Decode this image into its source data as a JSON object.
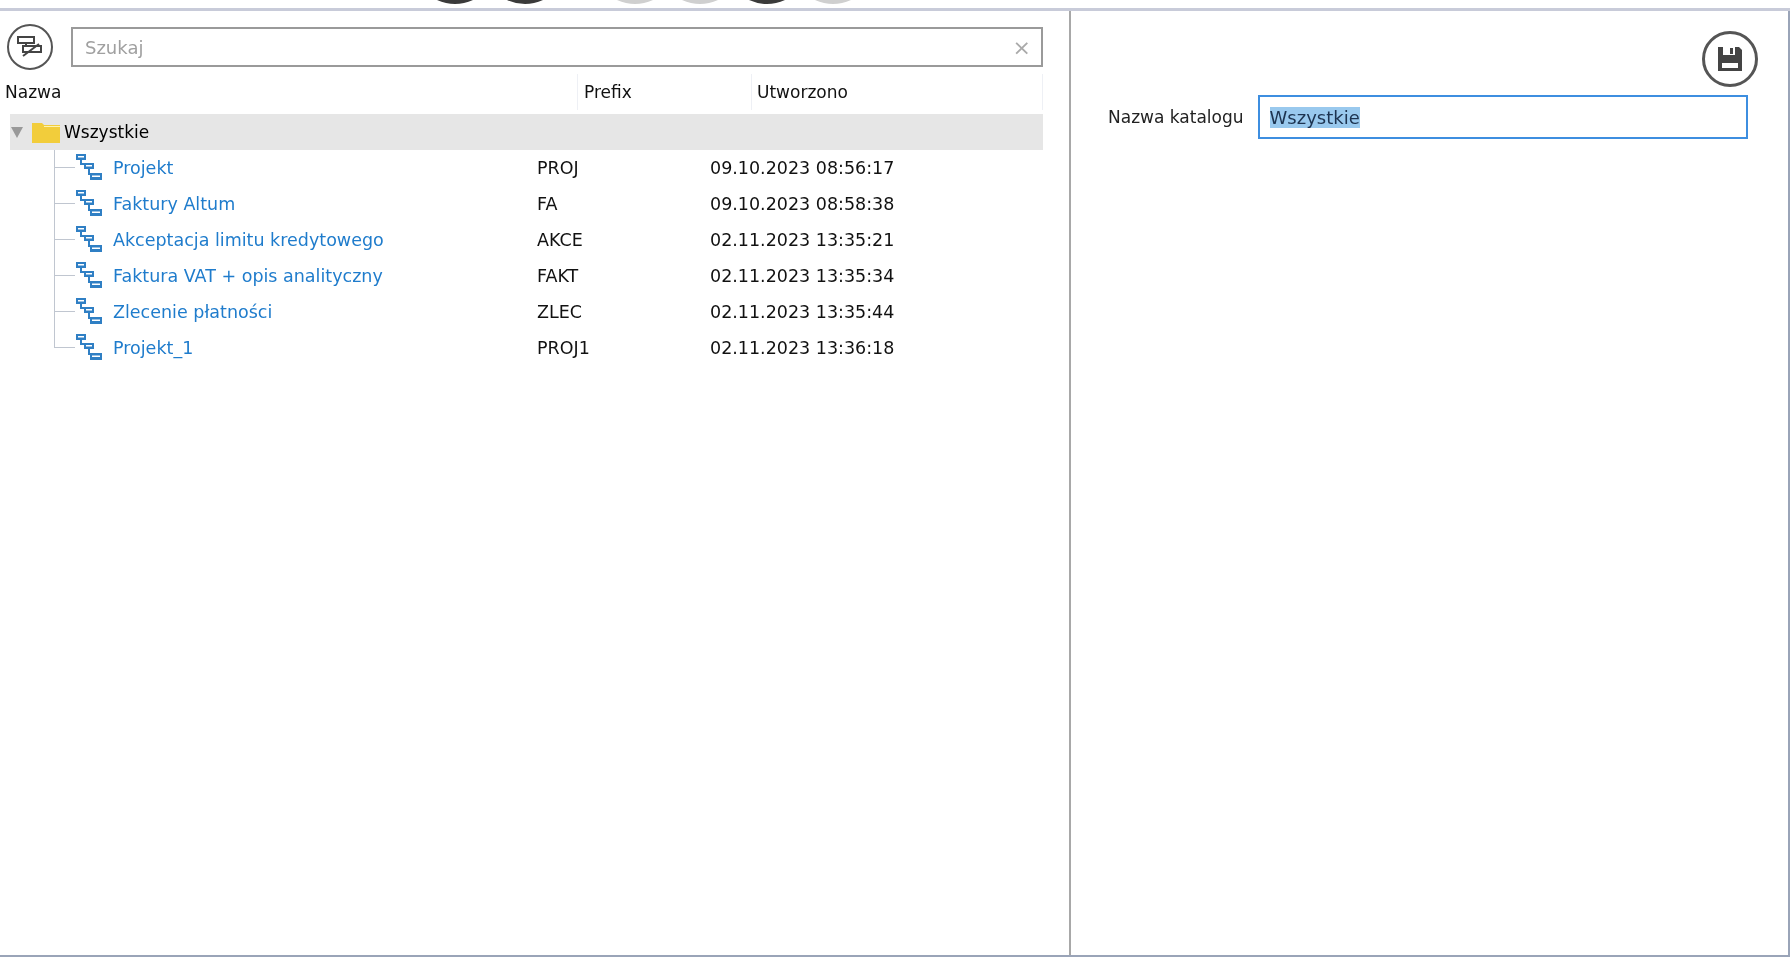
{
  "toolbar_icons": [
    {
      "disabled": false
    },
    {
      "disabled": false
    },
    {
      "disabled": true
    },
    {
      "disabled": true
    },
    {
      "disabled": false
    },
    {
      "disabled": true
    }
  ],
  "search": {
    "placeholder": "Szukaj",
    "clear_label": "×"
  },
  "table": {
    "columns": [
      "Nazwa",
      "Prefix",
      "Utworzono"
    ],
    "root": {
      "label": "Wszystkie",
      "expanded": true,
      "selected": true,
      "children": [
        {
          "name": "Projekt",
          "prefix": "PROJ",
          "created": "09.10.2023 08:56:17",
          "selected": false
        },
        {
          "name": "Faktury Altum",
          "prefix": "FA",
          "created": "09.10.2023 08:58:38",
          "selected": false
        },
        {
          "name": "Akceptacja limitu kredytowego",
          "prefix": "AKCE",
          "created": "02.11.2023 13:35:21",
          "selected": false
        },
        {
          "name": "Faktura VAT + opis analityczny",
          "prefix": "FAKT",
          "created": "02.11.2023 13:35:34",
          "selected": false
        },
        {
          "name": "Zlecenie płatności",
          "prefix": "ZLEC",
          "created": "02.11.2023 13:35:44",
          "selected": false
        },
        {
          "name": "Projekt_1",
          "prefix": "PROJ1",
          "created": "02.11.2023 13:36:18",
          "selected": false
        }
      ]
    }
  },
  "details": {
    "label": "Nazwa katalogu",
    "value": "Wszystkie",
    "value_selected": true
  }
}
